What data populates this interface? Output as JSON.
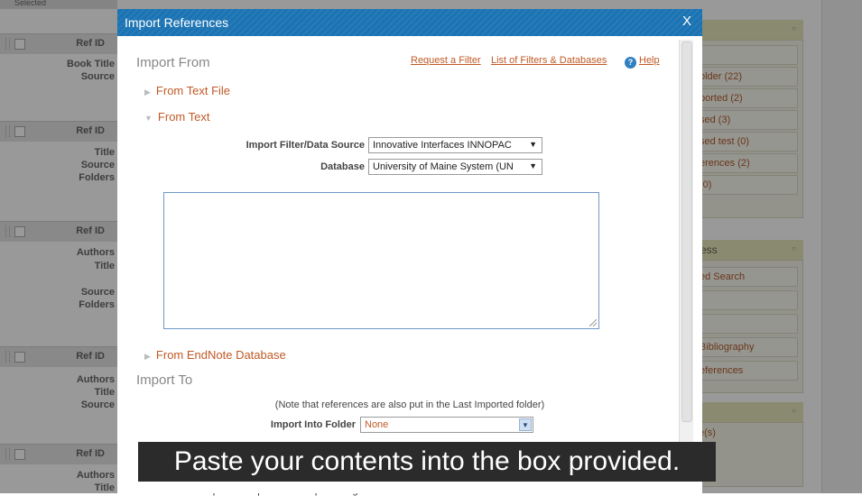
{
  "background": {
    "top_left_label": "Selected",
    "records": [
      {
        "header": "Ref ID",
        "labels": [
          "Book Title",
          "Source"
        ]
      },
      {
        "header": "Ref ID",
        "labels": [
          "Title",
          "Source",
          "Folders"
        ]
      },
      {
        "header": "Ref ID",
        "labels": [
          "Authors",
          "Title",
          "Source",
          "Folders"
        ]
      },
      {
        "header": "Ref ID",
        "labels": [
          "Authors",
          "Title",
          "Source"
        ]
      },
      {
        "header": "Ref ID",
        "labels": [
          "Authors",
          "Title"
        ]
      }
    ],
    "bottom_text": "The USI construction product representation practice guide",
    "right_panels": {
      "folders": [
        "older (22)",
        "ported (2)",
        "sed (3)",
        "sed test (0)",
        "erences (2)",
        "(0)"
      ],
      "section2_title": "ess",
      "section2_items": [
        "ed Search",
        "Bibliography",
        "eferences"
      ],
      "section3_items": [
        "e(s)"
      ]
    }
  },
  "dialog": {
    "title": "Import References",
    "close_label": "X",
    "import_from_heading": "Import From",
    "links": {
      "request_filter": "Request a Filter",
      "filters_list": "List of Filters & Databases",
      "help": "Help"
    },
    "sections": {
      "from_text_file": "From Text File",
      "from_text": "From Text",
      "from_endnote": "From EndNote Database"
    },
    "filter_label": "Import Filter/Data Source",
    "filter_value": "Innovative Interfaces INNOPAC",
    "database_label": "Database",
    "database_value": "University of Maine System (UN",
    "paste_box_value": "",
    "import_to_heading": "Import To",
    "note": "(Note that references are also put in the Last Imported folder)",
    "folder_label": "Import Into Folder",
    "folder_value": "None"
  },
  "caption": "Paste your contents into the box provided.",
  "colors": {
    "title_bar": "#1b73b3",
    "link": "#c05a26",
    "overlay": "rgba(0,0,0,0.40)",
    "caption_bg": "#2b2b2b"
  }
}
